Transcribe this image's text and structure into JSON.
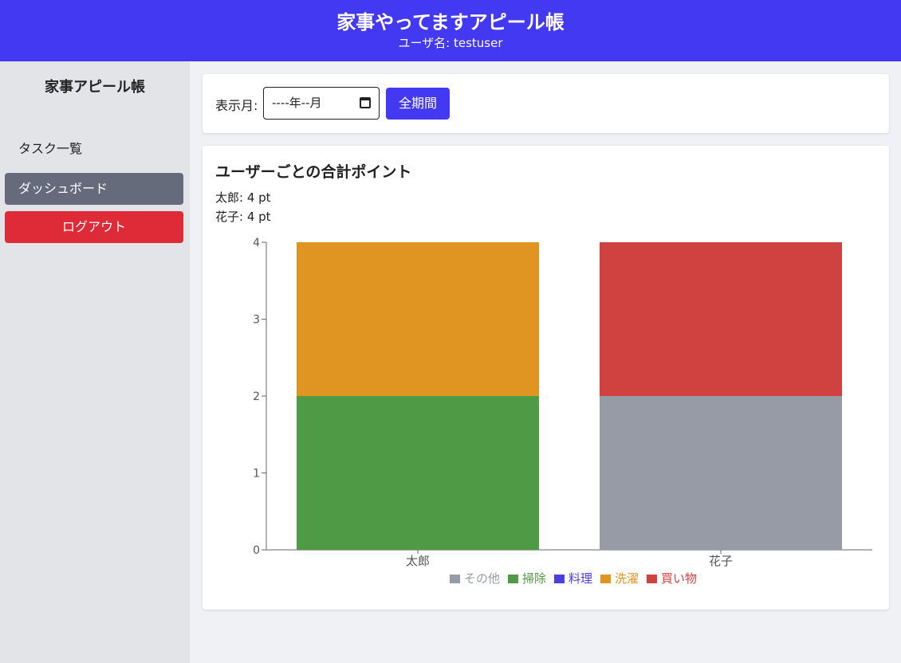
{
  "header": {
    "title": "家事やってますアピール帳",
    "user_label": "ユーザ名: testuser"
  },
  "sidebar": {
    "brand": "家事アピール帳",
    "items": [
      {
        "label": "タスク一覧"
      },
      {
        "label": "ダッシュボード"
      }
    ],
    "logout_label": "ログアウト"
  },
  "filter": {
    "label": "表示月:",
    "date_value": "----年--月",
    "all_button": "全期間"
  },
  "chart_card": {
    "title": "ユーザーごとの合計ポイント",
    "totals": [
      {
        "text": "太郎: 4 pt"
      },
      {
        "text": "花子: 4 pt"
      }
    ]
  },
  "chart_data": {
    "type": "bar",
    "stacked": true,
    "categories": [
      "太郎",
      "花子"
    ],
    "ylim": [
      0,
      4
    ],
    "yticks": [
      0,
      1,
      2,
      3,
      4
    ],
    "series": [
      {
        "name": "その他",
        "color": "#979ba6",
        "values": [
          0,
          2
        ]
      },
      {
        "name": "掃除",
        "color": "#4f9a45",
        "values": [
          2,
          0
        ]
      },
      {
        "name": "料理",
        "color": "#4a3fe0",
        "values": [
          0,
          0
        ]
      },
      {
        "name": "洗濯",
        "color": "#e09422",
        "values": [
          2,
          0
        ]
      },
      {
        "name": "買い物",
        "color": "#d04240",
        "values": [
          0,
          2
        ]
      }
    ],
    "legend_position": "bottom"
  }
}
